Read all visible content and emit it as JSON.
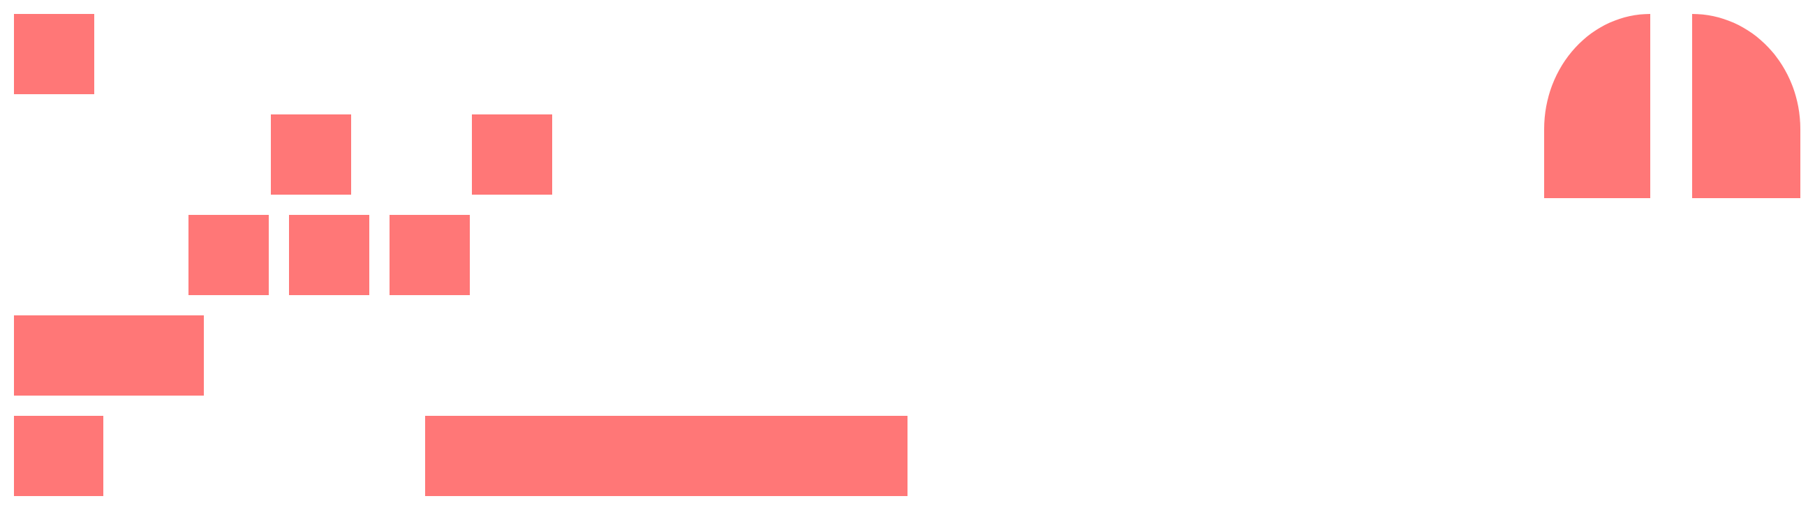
{
  "colors": {
    "background": "#ffffff",
    "block_fill": "#ff7777"
  },
  "shapes": [
    "block-top-left",
    "block-row2-a",
    "block-row2-b",
    "block-row3-a",
    "block-row3-b",
    "block-row3-c",
    "block-wide",
    "block-bottom-left",
    "block-bottom-long",
    "arch-left",
    "arch-right"
  ]
}
